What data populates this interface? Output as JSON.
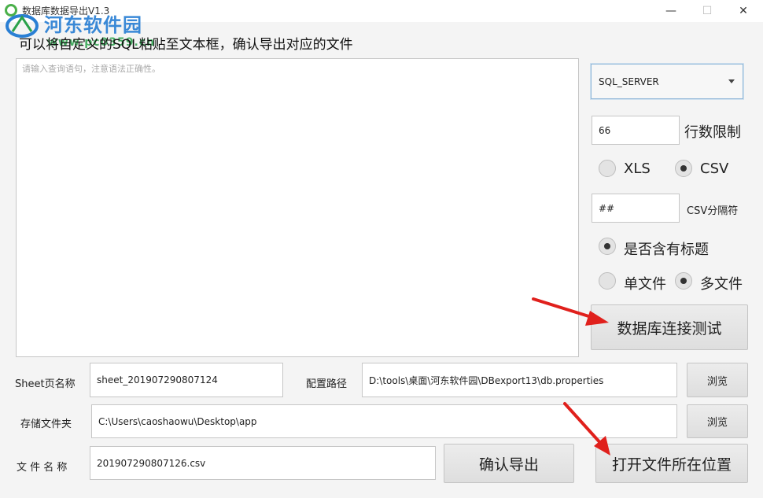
{
  "window": {
    "title": "数据库数据导出V1.3",
    "minimize": "—",
    "maximize": "☐",
    "close": "✕"
  },
  "watermark": {
    "brand": "河东软件园",
    "url": "www.pc0359.cn"
  },
  "instruction": "可以将自定义的SQL粘贴至文本框，确认导出对应的文件",
  "sql": {
    "placeholder": "请输入查询语句，注意语法正确性。",
    "value": ""
  },
  "db_type": {
    "selected": "SQL_SERVER"
  },
  "row_limit": {
    "value": "66",
    "label": "行数限制"
  },
  "format": {
    "xls": "XLS",
    "csv": "CSV",
    "selected": "CSV"
  },
  "csv_separator": {
    "value": "##",
    "label": "CSV分隔符"
  },
  "has_header": {
    "label": "是否含有标题",
    "checked": true
  },
  "file_mode": {
    "single": "单文件",
    "multi": "多文件",
    "selected": "多文件"
  },
  "test_button": "数据库连接测试",
  "sheet": {
    "label": "Sheet页名称",
    "value": "sheet_201907290807124"
  },
  "config_path": {
    "label": "配置路径",
    "value": "D:\\tools\\桌面\\河东软件园\\DBexport13\\db.properties",
    "browse": "浏览"
  },
  "folder": {
    "label": "存储文件夹",
    "value": "C:\\Users\\caoshaowu\\Desktop\\app",
    "browse": "浏览"
  },
  "filename": {
    "label": "文 件 名 称",
    "value": "201907290807126.csv"
  },
  "export_button": "确认导出",
  "open_location_button": "打开文件所在位置",
  "colors": {
    "annotation_arrow": "#e0201c",
    "focus_border": "#8fb6d8",
    "watermark_blue": "#2a7fd4",
    "watermark_green": "#2aa14a"
  }
}
